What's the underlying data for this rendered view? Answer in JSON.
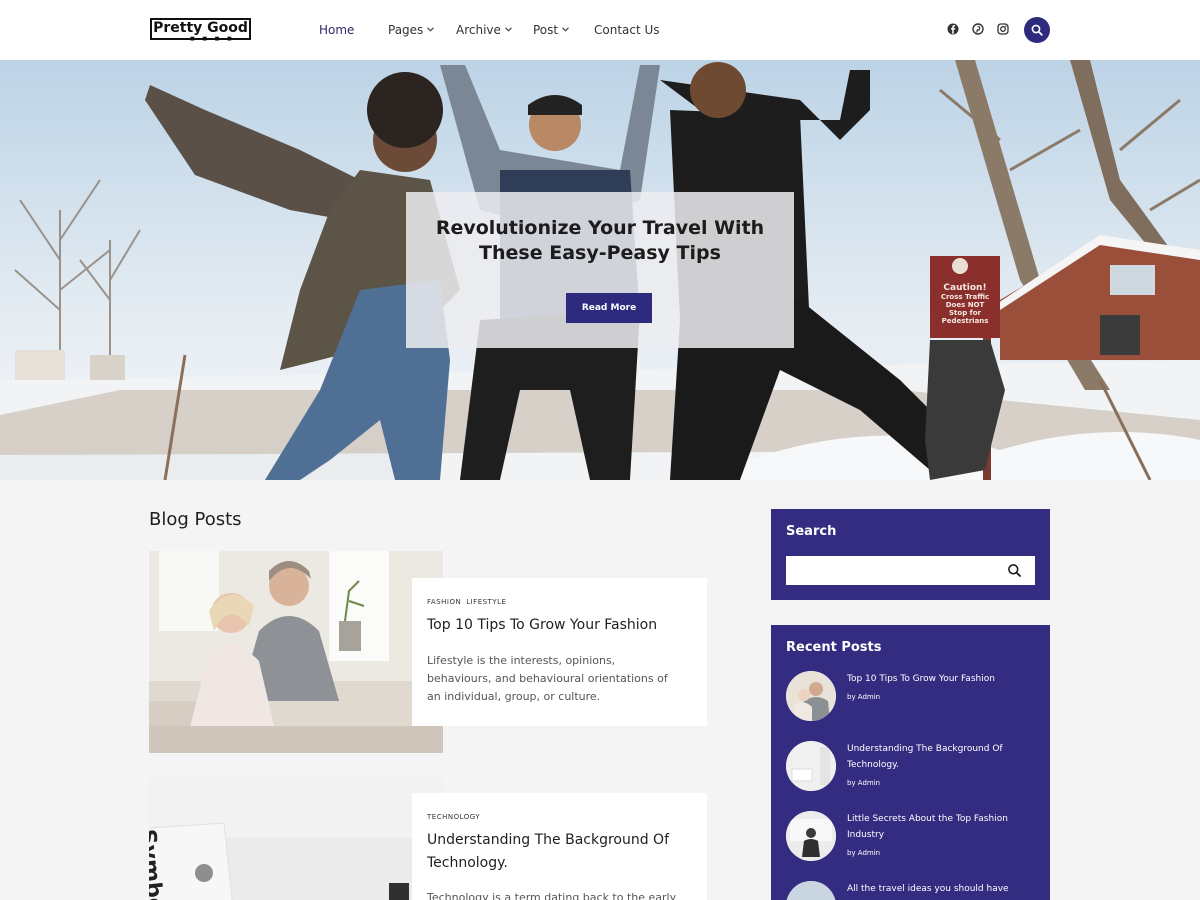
{
  "header": {
    "logo_text": "Pretty Good",
    "logo_dots": "■ ■ ■ ■",
    "nav": [
      {
        "label": "Home"
      },
      {
        "label": "Pages",
        "dropdown": true
      },
      {
        "label": "Archive",
        "dropdown": true
      },
      {
        "label": "Post",
        "dropdown": true
      },
      {
        "label": "Contact Us"
      }
    ],
    "social_icons": [
      "facebook-icon",
      "pinterest-icon",
      "instagram-icon"
    ],
    "search_icon": "search-icon"
  },
  "hero": {
    "title_line1": "Revolutionize Your Travel With",
    "title_line2": "These Easy-Peasy Tips",
    "button_label": "Read More",
    "sign_lines": [
      "Caution!",
      "Cross Traffic",
      "Does NOT",
      "Stop for",
      "Pedestrians"
    ]
  },
  "blog": {
    "heading": "Blog Posts",
    "posts": [
      {
        "categories": [
          "FASHION",
          "LIFESTYLE"
        ],
        "title": "Top 10 Tips To Grow Your Fashion",
        "excerpt_lines": [
          "Lifestyle is the interests, opinions,",
          "behaviours, and behavioural orientations of",
          "an individual, group, or culture."
        ]
      },
      {
        "categories": [
          "TECHNOLOGY"
        ],
        "title_lines": [
          "Understanding The Background Of",
          "Technology."
        ],
        "excerpt": "Technology is a term dating back to the early",
        "image_text": "Symbo"
      }
    ]
  },
  "sidebar": {
    "search": {
      "title": "Search",
      "placeholder": ""
    },
    "recent": {
      "title": "Recent Posts",
      "items": [
        {
          "title_lines": [
            "Top 10 Tips To Grow Your Fashion"
          ],
          "meta": "by Admin"
        },
        {
          "title_lines": [
            "Understanding The Background Of",
            "Technology."
          ],
          "meta": "by Admin"
        },
        {
          "title_lines": [
            "Little Secrets About the Top Fashion",
            "Industry"
          ],
          "meta": "by Admin"
        },
        {
          "title_lines": [
            "All the travel ideas you should have"
          ],
          "meta": ""
        }
      ]
    }
  },
  "colors": {
    "accent": "#2e2a7e",
    "sidebar_bg": "#332c80",
    "page_bg": "#f4f4f4"
  }
}
